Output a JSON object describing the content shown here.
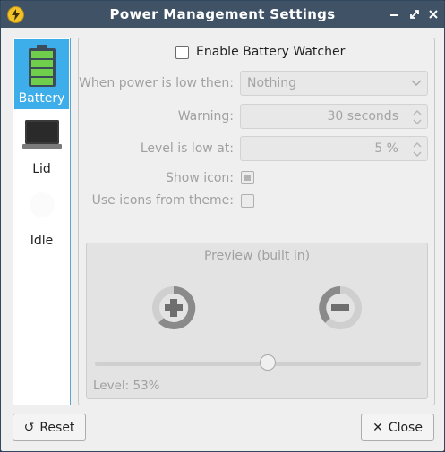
{
  "window": {
    "title": "Power Management Settings",
    "app_icon": "lightning-bolt-icon",
    "controls": [
      "minimize-icon",
      "maximize-icon",
      "close-icon"
    ]
  },
  "sidebar": {
    "items": [
      {
        "label": "Battery",
        "icon": "battery-icon",
        "active": true
      },
      {
        "label": "Lid",
        "icon": "laptop-icon",
        "active": false
      },
      {
        "label": "Idle",
        "icon": "idle-icon",
        "active": false
      }
    ]
  },
  "battery": {
    "enable_label": "Enable Battery Watcher",
    "enable_checked": false,
    "low_action_label": "When power is low then:",
    "low_action_value": "Nothing",
    "warning_label": "Warning:",
    "warning_value": "30 seconds",
    "level_label": "Level is low at:",
    "level_value": "5 %",
    "show_icon_label": "Show icon:",
    "show_icon_checked": true,
    "theme_icons_label": "Use icons from theme:",
    "theme_icons_checked": false
  },
  "preview": {
    "title": "Preview (built in)",
    "level_text": "Level: 53%",
    "level_fraction": 0.53,
    "icons": [
      "battery-charging-plus-icon",
      "battery-discharging-minus-icon"
    ]
  },
  "buttons": {
    "reset_label": "Reset",
    "close_label": "Close"
  },
  "colors": {
    "accent": "#3daee9",
    "titlebar": "#3f5266",
    "battery_green": "#5bb53b"
  }
}
